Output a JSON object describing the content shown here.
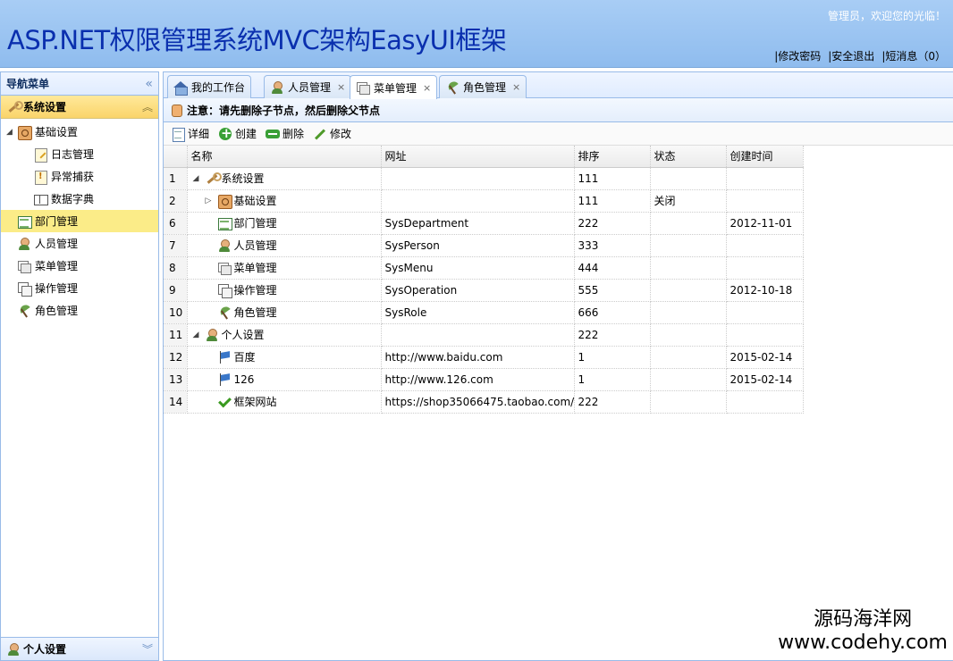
{
  "header": {
    "title": "ASP.NET权限管理系统MVC架构EasyUI框架",
    "welcome": "管理员，欢迎您的光临！",
    "links": [
      "|修改密码",
      "|安全退出",
      "|短消息（0）"
    ]
  },
  "nav": {
    "title": "导航菜单",
    "section": "系统设置",
    "bottom_section": "个人设置",
    "items": [
      {
        "label": "基础设置",
        "icon": "box-icon",
        "level": 0,
        "toggle": "◢"
      },
      {
        "label": "日志管理",
        "icon": "log-icon",
        "level": 1
      },
      {
        "label": "异常捕获",
        "icon": "warning-icon",
        "level": 1
      },
      {
        "label": "数据字典",
        "icon": "book-icon",
        "level": 1
      },
      {
        "label": "部门管理",
        "icon": "department-icon",
        "level": 0,
        "selected": true
      },
      {
        "label": "人员管理",
        "icon": "user-icon",
        "level": 0
      },
      {
        "label": "菜单管理",
        "icon": "menu-icon",
        "level": 0
      },
      {
        "label": "操作管理",
        "icon": "operation-icon",
        "level": 0
      },
      {
        "label": "角色管理",
        "icon": "role-icon",
        "level": 0
      }
    ]
  },
  "tabs": [
    {
      "label": "我的工作台",
      "icon": "home-icon",
      "closable": false
    },
    {
      "label": "人员管理",
      "icon": "user-icon",
      "closable": true
    },
    {
      "label": "菜单管理",
      "icon": "menu-icon",
      "closable": true,
      "active": true
    },
    {
      "label": "角色管理",
      "icon": "role-icon",
      "closable": true
    }
  ],
  "notice": "注意：请先删除子节点，然后删除父节点",
  "toolbar": {
    "detail": "详细",
    "create": "创建",
    "delete": "删除",
    "edit": "修改"
  },
  "grid": {
    "columns": [
      "名称",
      "网址",
      "排序",
      "状态",
      "创建时间"
    ],
    "rows": [
      {
        "rn": "1",
        "name": "系统设置",
        "icon": "wrench-icon",
        "indent": 1,
        "toggle": "◢",
        "url": "",
        "sort": "111",
        "status": "",
        "created": ""
      },
      {
        "rn": "2",
        "name": "基础设置",
        "icon": "box-icon",
        "indent": 2,
        "toggle": "▷",
        "url": "",
        "sort": "111",
        "status": "关闭",
        "created": ""
      },
      {
        "rn": "6",
        "name": "部门管理",
        "icon": "department-icon",
        "indent": 3,
        "toggle": "",
        "url": "SysDepartment",
        "sort": "222",
        "status": "",
        "created": "2012-11-01"
      },
      {
        "rn": "7",
        "name": "人员管理",
        "icon": "user-icon",
        "indent": 3,
        "toggle": "",
        "url": "SysPerson",
        "sort": "333",
        "status": "",
        "created": ""
      },
      {
        "rn": "8",
        "name": "菜单管理",
        "icon": "menu-icon",
        "indent": 3,
        "toggle": "",
        "url": "SysMenu",
        "sort": "444",
        "status": "",
        "created": ""
      },
      {
        "rn": "9",
        "name": "操作管理",
        "icon": "operation-icon",
        "indent": 3,
        "toggle": "",
        "url": "SysOperation",
        "sort": "555",
        "status": "",
        "created": "2012-10-18"
      },
      {
        "rn": "10",
        "name": "角色管理",
        "icon": "role-icon",
        "indent": 3,
        "toggle": "",
        "url": "SysRole",
        "sort": "666",
        "status": "",
        "created": ""
      },
      {
        "rn": "11",
        "name": "个人设置",
        "icon": "user-icon",
        "indent": 1,
        "toggle": "◢",
        "url": "",
        "sort": "222",
        "status": "",
        "created": ""
      },
      {
        "rn": "12",
        "name": "百度",
        "icon": "flag-icon",
        "indent": 3,
        "toggle": "",
        "url": "http://www.baidu.com",
        "sort": "1",
        "status": "",
        "created": "2015-02-14"
      },
      {
        "rn": "13",
        "name": "126",
        "icon": "flag-icon",
        "indent": 3,
        "toggle": "",
        "url": "http://www.126.com",
        "sort": "1",
        "status": "",
        "created": "2015-02-14"
      },
      {
        "rn": "14",
        "name": "框架网站",
        "icon": "check-icon",
        "indent": 3,
        "toggle": "",
        "url": "https://shop35066475.taobao.com/",
        "sort": "222",
        "status": "",
        "created": ""
      }
    ]
  },
  "watermark": {
    "line1": "源码海洋网",
    "line2": "www.codehy.com"
  }
}
